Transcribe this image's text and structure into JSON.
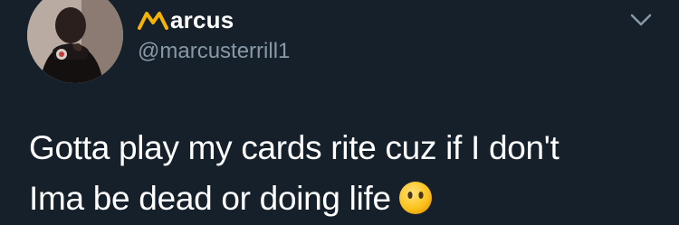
{
  "tweet": {
    "display_name": "arcus",
    "handle": "@marcusterrill1",
    "text_lines": [
      "Gotta play my cards rite cuz if I don't",
      "Ima be dead or doing life"
    ],
    "emoji": "face-without-mouth",
    "name_mark_color": "#f5b400",
    "background_color": "#15202b",
    "handle_color": "#8899a6"
  },
  "icons": {
    "menu": "chevron-down-icon",
    "avatar": "avatar"
  }
}
